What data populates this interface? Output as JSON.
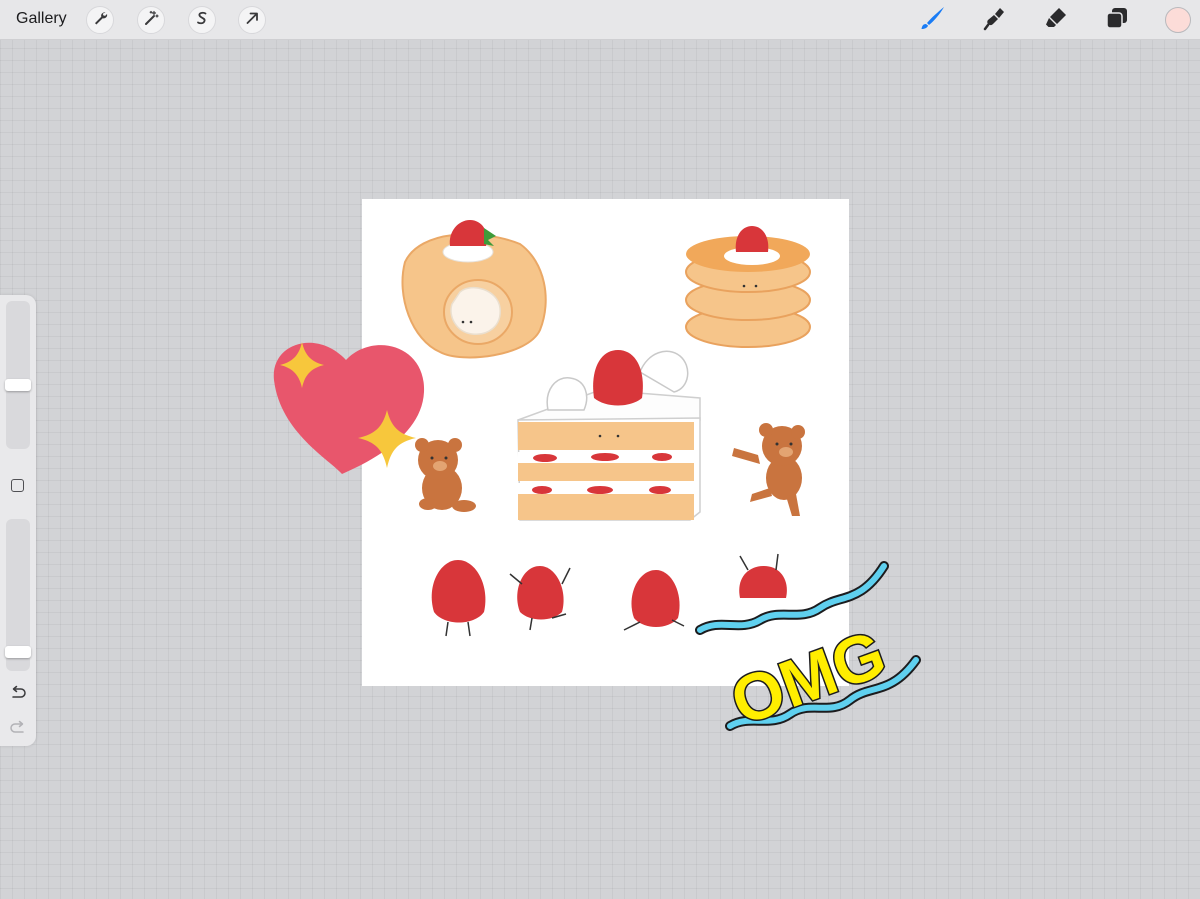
{
  "topbar": {
    "gallery_label": "Gallery",
    "left_tools": [
      "wrench-icon",
      "magic-wand-icon",
      "selection-icon",
      "transform-arrow-icon"
    ],
    "right_tools": [
      "brush-icon",
      "smudge-icon",
      "eraser-icon",
      "layers-icon"
    ],
    "active_tool": "brush",
    "current_color": "#fcdcd8",
    "accent": "#1a7cf5"
  },
  "sidebar": {
    "brush_size_level": 0.43,
    "opacity_level": 0.09,
    "controls": [
      "size-slider",
      "modify-button",
      "opacity-slider",
      "undo-icon",
      "redo-icon"
    ]
  },
  "artwork": {
    "sticker_text": "OMG",
    "colors": {
      "heart": "#e8566c",
      "sparkle": "#f7c73c",
      "strawberry": "#d8363a",
      "sponge": "#f6c58a",
      "bear": "#c9743f",
      "omg_fill": "#ffee00",
      "wave": "#5fd0ef"
    }
  }
}
